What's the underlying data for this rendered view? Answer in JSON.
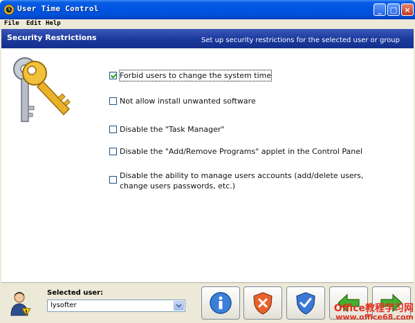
{
  "window": {
    "title": "User Time Control",
    "buttons": {
      "minimize": "_",
      "maximize": "□",
      "close": "×"
    }
  },
  "menu": [
    "File",
    "Edit",
    "Help"
  ],
  "header": {
    "title": "Security Restrictions",
    "subtitle": "Set up security restrictions for the selected user or group"
  },
  "options": [
    {
      "label": "Forbid users to change the system time",
      "checked": true
    },
    {
      "label": "Not allow install unwanted software",
      "checked": false
    },
    {
      "label": "Disable the \"Task Manager\"",
      "checked": false
    },
    {
      "label": "Disable the \"Add/Remove Programs\" applet in the Control Panel",
      "checked": false
    },
    {
      "label": "Disable the ability to manage users accounts (add/delete users,",
      "label2": "change users passwords, etc.)",
      "checked": false
    }
  ],
  "bottom": {
    "selected_user_label": "Selected user:",
    "selected_user_value": "lysofter",
    "buttons": [
      "info-icon",
      "shield-x-icon",
      "shield-check-icon",
      "back-arrow-icon",
      "forward-arrow-icon"
    ]
  },
  "watermark": {
    "line1": "Office教程学习网",
    "line2": "www.office68.com"
  },
  "colors": {
    "title_bar": "#0054e3",
    "header_band": "#1d3b9e",
    "check_green": "#21a121",
    "watermark_red": "#e0301e"
  }
}
